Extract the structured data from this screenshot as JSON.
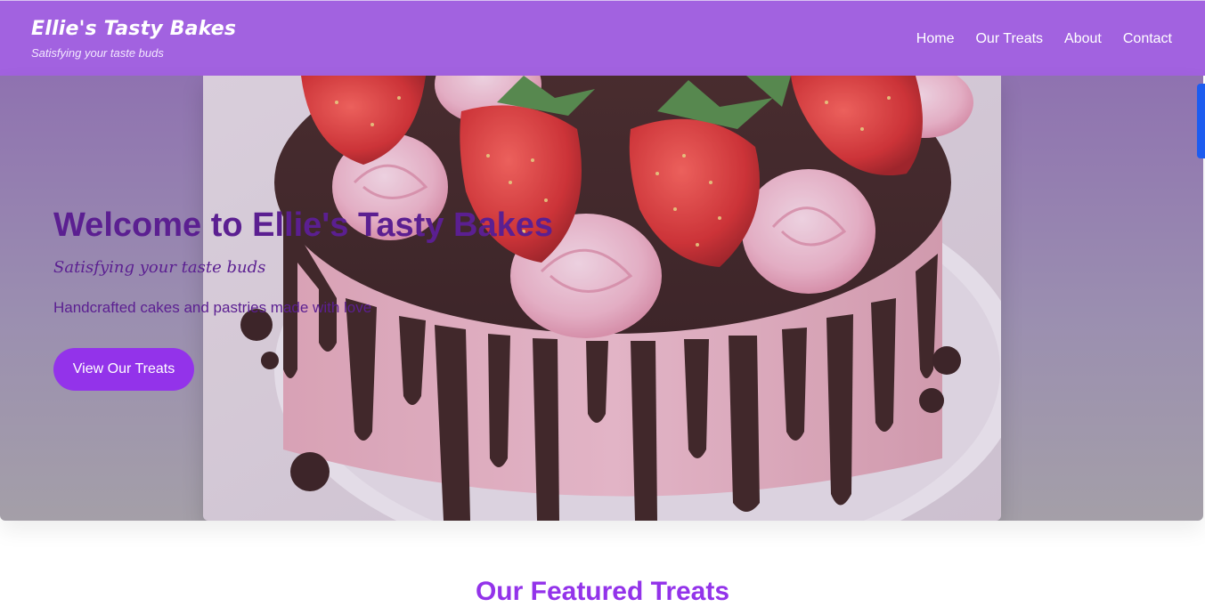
{
  "header": {
    "brand_title": "Ellie's Tasty Bakes",
    "brand_tagline": "Satisfying your taste buds",
    "nav": [
      "Home",
      "Our Treats",
      "About",
      "Contact"
    ],
    "background_color": "#a262e0"
  },
  "hero": {
    "title": "Welcome to Ellie's Tasty Bakes",
    "subtitle": "Satisfying your taste buds",
    "description": "Handcrafted cakes and pastries made with love",
    "button_label": "View Our Treats",
    "button_color": "#9333ea",
    "text_color": "#5b1f91",
    "image": "strawberry-chocolate-drip-cake-photo"
  },
  "featured": {
    "heading": "Our Featured Treats",
    "heading_color": "#9333ea"
  }
}
